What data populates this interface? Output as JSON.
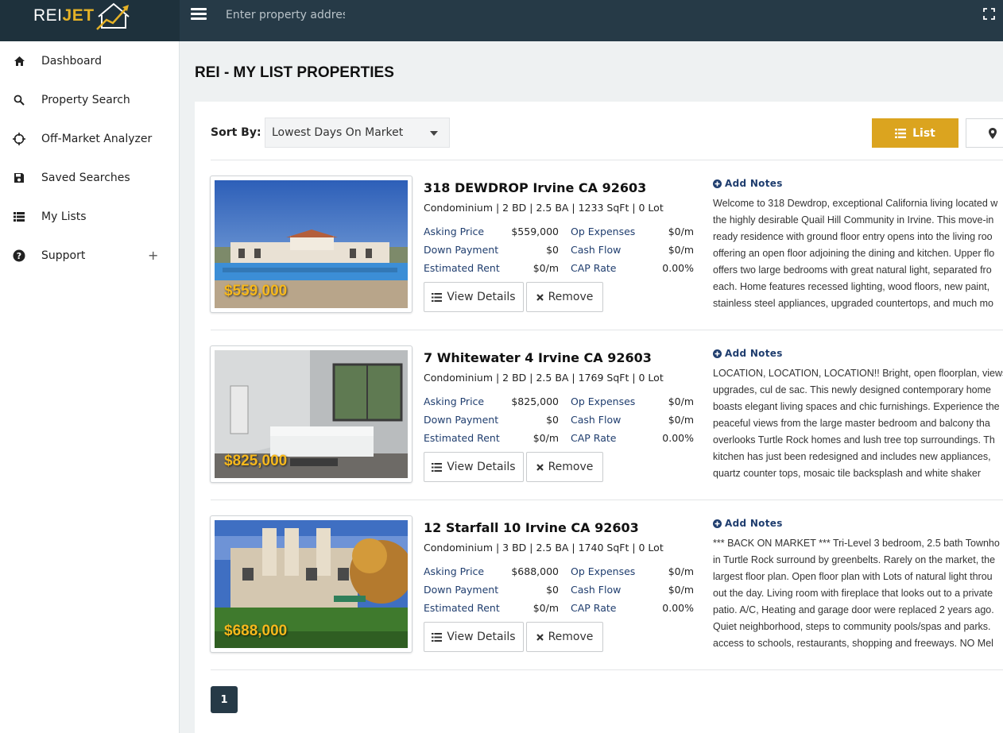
{
  "app": {
    "logo_rei": "REI",
    "logo_jet": "JET",
    "search_placeholder": "Enter property address"
  },
  "sidebar": {
    "items": [
      {
        "label": "Dashboard",
        "icon": "home-icon"
      },
      {
        "label": "Property Search",
        "icon": "search-icon"
      },
      {
        "label": "Off-Market Analyzer",
        "icon": "crosshair-icon"
      },
      {
        "label": "Saved Searches",
        "icon": "floppy-disk-icon"
      },
      {
        "label": "My Lists",
        "icon": "list-icon"
      },
      {
        "label": "Support",
        "icon": "question-circle-icon",
        "expand": "+"
      }
    ]
  },
  "page": {
    "title": "REI - MY LIST PROPERTIES",
    "sort_label": "Sort By:",
    "sort_value": "Lowest Days On Market",
    "list_button": "List",
    "pagination": [
      "1"
    ]
  },
  "labels": {
    "asking_price": "Asking Price",
    "down_payment": "Down Payment",
    "estimated_rent": "Estimated Rent",
    "op_expenses": "Op Expenses",
    "cash_flow": "Cash Flow",
    "cap_rate": "CAP Rate",
    "view_details": "View Details",
    "remove": "Remove",
    "add_notes": "Add Notes"
  },
  "properties": [
    {
      "photo_price": "$559,000",
      "title": "318 DEWDROP Irvine CA 92603",
      "specs": "Condominium | 2 BD | 2.5 BA | 1233 SqFt | 0 Lot",
      "asking_price": "$559,000",
      "down_payment": "$0",
      "estimated_rent": "$0/m",
      "op_expenses": "$0/m",
      "cash_flow": "$0/m",
      "cap_rate": "0.00%",
      "description_lines": [
        "Welcome to 318 Dewdrop, exceptional California living located w",
        "the highly desirable Quail Hill Community in Irvine. This move-in",
        "ready residence with ground floor entry opens into the living roo",
        "offering an open floor adjoining the dining and kitchen. Upper flo",
        "offers two large bedrooms with great natural light, separated fro",
        "each. Home features recessed lighting, wood floors, new paint,",
        "stainless steel appliances, upgraded countertops, and much mo"
      ]
    },
    {
      "photo_price": "$825,000",
      "title": "7 Whitewater 4 Irvine CA 92603",
      "specs": "Condominium | 2 BD | 2.5 BA | 1769 SqFt | 0 Lot",
      "asking_price": "$825,000",
      "down_payment": "$0",
      "estimated_rent": "$0/m",
      "op_expenses": "$0/m",
      "cash_flow": "$0/m",
      "cap_rate": "0.00%",
      "description_lines": [
        "LOCATION, LOCATION, LOCATION!! Bright, open floorplan, views",
        "upgrades, cul de sac. This newly designed contemporary home",
        "boasts elegant living spaces and chic furnishings. Experience the",
        "peaceful views from the large master bedroom and balcony tha",
        "overlooks Turtle Rock homes and lush tree top surroundings. Th",
        "kitchen has just been redesigned and includes new appliances,",
        "quartz counter tops, mosaic tile backsplash and white shaker"
      ]
    },
    {
      "photo_price": "$688,000",
      "title": "12 Starfall 10 Irvine CA 92603",
      "specs": "Condominium | 3 BD | 2.5 BA | 1740 SqFt | 0 Lot",
      "asking_price": "$688,000",
      "down_payment": "$0",
      "estimated_rent": "$0/m",
      "op_expenses": "$0/m",
      "cash_flow": "$0/m",
      "cap_rate": "0.00%",
      "description_lines": [
        "*** BACK ON MARKET *** Tri-Level 3 bedroom, 2.5 bath Townho",
        "in Turtle Rock surround by greenbelts. Rarely on the market, the",
        "largest floor plan. Open floor plan with Lots of natural light throu",
        "out the day. Living room with fireplace that looks out to a private",
        "patio. A/C, Heating and garage door were replaced 2 years ago.",
        "Quiet neighborhood, steps to community pools/spas and parks.",
        "access to schools, restaurants, shopping and freeways. NO Mel"
      ]
    }
  ]
}
